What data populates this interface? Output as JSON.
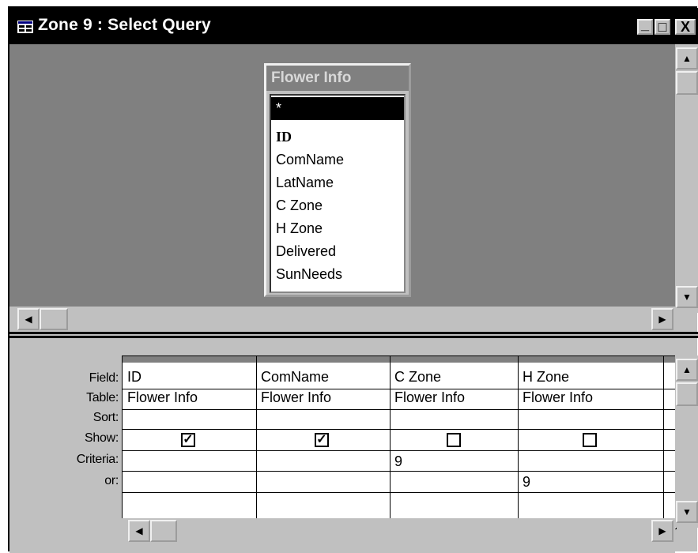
{
  "window": {
    "title": "Zone 9 : Select Query",
    "buttons": {
      "minimize": "_",
      "maximize": "□",
      "close": "X"
    }
  },
  "field_list": {
    "title": "Flower Info",
    "items": [
      "*",
      "ID",
      "ComName",
      "LatName",
      "C Zone",
      "H Zone",
      "Delivered",
      "SunNeeds"
    ],
    "selected_index": 0,
    "key_index": 1
  },
  "grid": {
    "row_labels": [
      "Field:",
      "Table:",
      "Sort:",
      "Show:",
      "Criteria:",
      "or:"
    ],
    "columns": [
      {
        "field": "ID",
        "table": "Flower Info",
        "sort": "",
        "show": true,
        "criteria": "",
        "or": ""
      },
      {
        "field": "ComName",
        "table": "Flower Info",
        "sort": "",
        "show": true,
        "criteria": "",
        "or": ""
      },
      {
        "field": "C Zone",
        "table": "Flower Info",
        "sort": "",
        "show": false,
        "criteria": "9",
        "or": ""
      },
      {
        "field": "H Zone",
        "table": "Flower Info",
        "sort": "",
        "show": false,
        "criteria": "",
        "or": "9"
      }
    ]
  },
  "colors": {
    "face": "#c0c0c0",
    "titlebar": "#000000",
    "workspace": "#808080"
  }
}
